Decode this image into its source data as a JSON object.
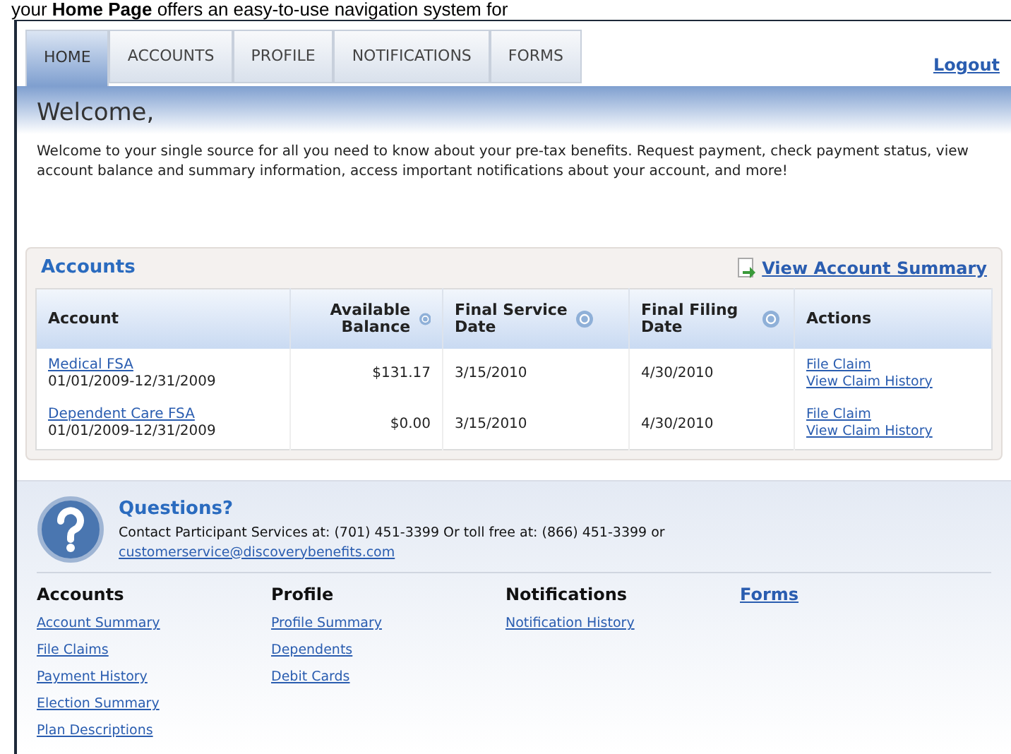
{
  "caption": "your **Home Page** offers an easy-to-use navigation system for",
  "tabs": [
    {
      "label": "HOME",
      "selected": true
    },
    {
      "label": "ACCOUNTS",
      "selected": false
    },
    {
      "label": "PROFILE",
      "selected": false
    },
    {
      "label": "NOTIFICATIONS",
      "selected": false
    },
    {
      "label": "FORMS",
      "selected": false
    }
  ],
  "logout": "Logout",
  "welcome": {
    "title": "Welcome,",
    "text": "Welcome to your single source for all you need to know about your pre-tax benefits. Request payment, check payment status, view account balance and summary information, access important notifications about your account, and more!"
  },
  "accounts": {
    "title": "Accounts",
    "summary_link": "View Account Summary",
    "columns": [
      {
        "label": "Account",
        "help": false
      },
      {
        "label": "Available Balance",
        "help": true
      },
      {
        "label": "Final Service Date",
        "help": true
      },
      {
        "label": "Final Filing Date",
        "help": true
      },
      {
        "label": "Actions",
        "help": false
      }
    ],
    "rows": [
      {
        "account": "Medical FSA",
        "period": "01/01/2009-12/31/2009",
        "balance": "$131.17",
        "service": "3/15/2010",
        "filing": "4/30/2010",
        "actions": [
          "File Claim",
          "View Claim History"
        ]
      },
      {
        "account": "Dependent Care FSA",
        "period": "01/01/2009-12/31/2009",
        "balance": "$0.00",
        "service": "3/15/2010",
        "filing": "4/30/2010",
        "actions": [
          "File Claim",
          "View Claim History"
        ]
      }
    ]
  },
  "questions": {
    "title": "Questions?",
    "text": "Contact Participant Services at: (701) 451-3399 Or toll free at: (866) 451-3399 or",
    "email": "customerservice@discoverybenefits.com"
  },
  "footer_links": [
    {
      "heading": "Accounts",
      "heading_link": false,
      "links": [
        "Account Summary",
        "File Claims",
        "Payment History",
        "Election Summary",
        "Plan Descriptions"
      ]
    },
    {
      "heading": "Profile",
      "heading_link": false,
      "links": [
        "Profile Summary",
        "Dependents",
        "Debit Cards"
      ]
    },
    {
      "heading": "Notifications",
      "heading_link": false,
      "links": [
        "Notification History"
      ]
    },
    {
      "heading": "Forms",
      "heading_link": true
    }
  ]
}
